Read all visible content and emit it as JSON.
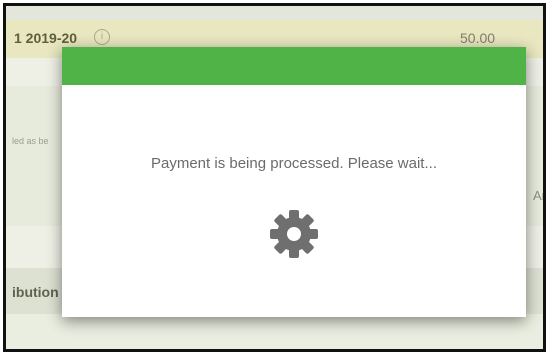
{
  "background": {
    "row_year": "1 2019-20",
    "row_info_icon": "info-icon",
    "row_amount": "50.00",
    "truncated_small_text": "led as be",
    "truncated_am": "Am",
    "truncated_ibution": "ibution"
  },
  "modal": {
    "header_color": "#4fb347",
    "message": "Payment is being processed. Please wait...",
    "icon": "gear-icon"
  }
}
